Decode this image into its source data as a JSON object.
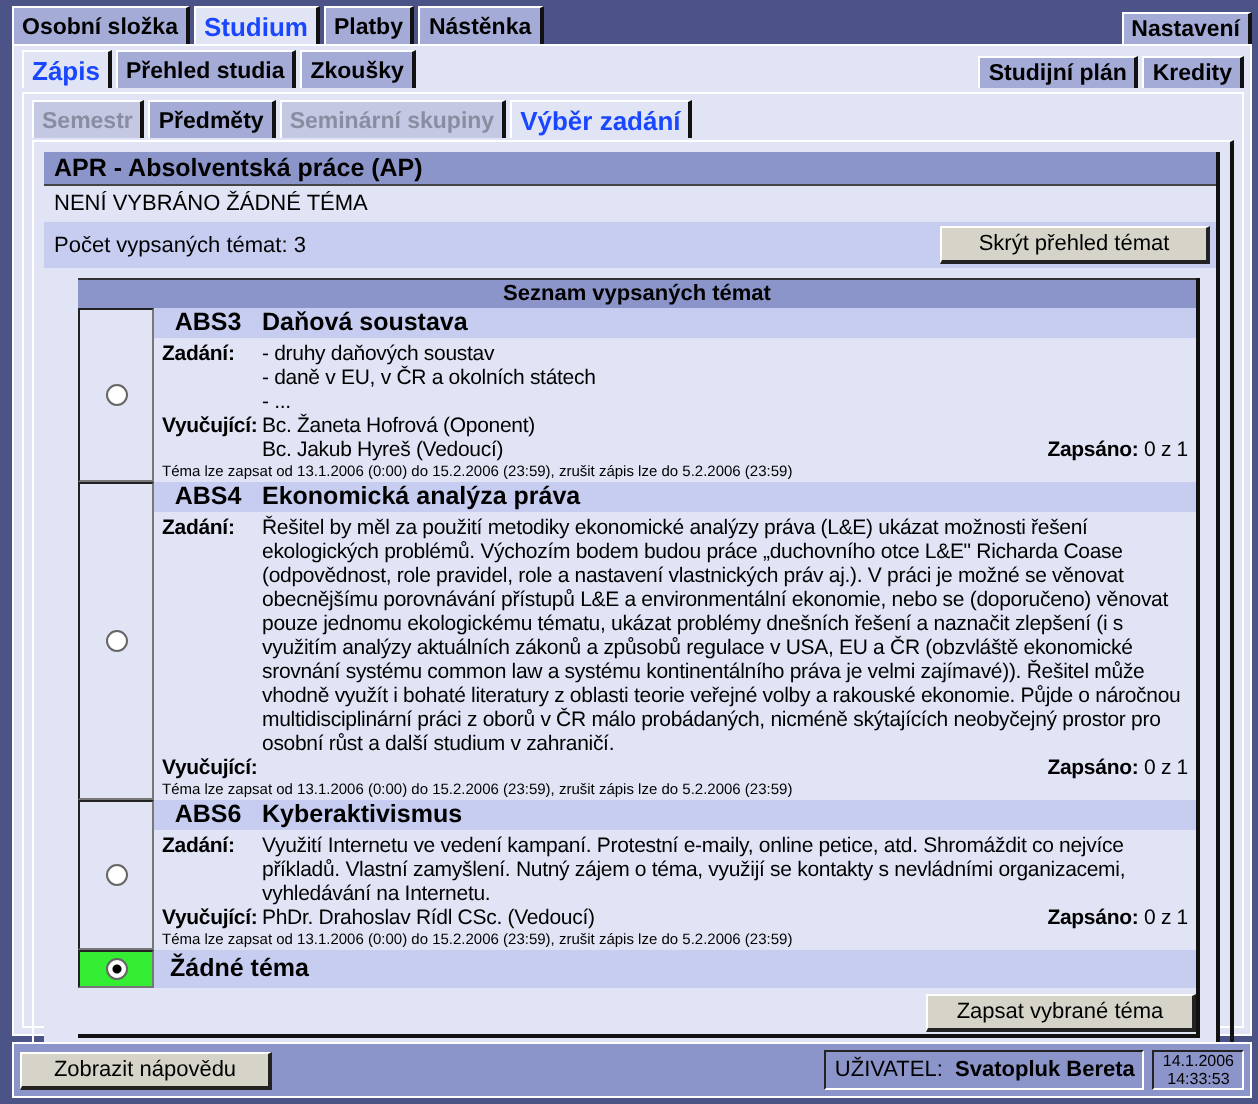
{
  "top_tabs": [
    {
      "label": "Osobní složka",
      "selected": false
    },
    {
      "label": "Studium",
      "selected": true
    },
    {
      "label": "Platby",
      "selected": false
    },
    {
      "label": "Nástěnka",
      "selected": false
    }
  ],
  "top_right_tabs": [
    {
      "label": "Nastavení",
      "selected": false
    }
  ],
  "sub_tabs": [
    {
      "label": "Zápis",
      "selected": true
    },
    {
      "label": "Přehled studia",
      "selected": false
    },
    {
      "label": "Zkoušky",
      "selected": false
    }
  ],
  "sub_right_tabs": [
    {
      "label": "Studijní plán",
      "selected": false
    },
    {
      "label": "Kredity",
      "selected": false
    }
  ],
  "section_tabs": [
    {
      "label": "Semestr",
      "selected": false,
      "disabled": true
    },
    {
      "label": "Předměty",
      "selected": false,
      "disabled": false
    },
    {
      "label": "Seminární skupiny",
      "selected": false,
      "disabled": true
    },
    {
      "label": "Výběr zadání",
      "selected": true,
      "disabled": false
    }
  ],
  "course": {
    "title": "APR - Absolventská práce (AP)",
    "status": "NENÍ VYBRÁNO ŽÁDNÉ TÉMA",
    "count": "Počet vypsaných témat: 3",
    "toggle_button": "Skrýt přehled témat"
  },
  "topics": {
    "heading": "Seznam vypsaných témat",
    "items": [
      {
        "kind": "topic",
        "selected": false,
        "code": "ABS3",
        "title": "Daňová soustava",
        "assignment_label": "Zadání:",
        "assignment": [
          "- druhy daňových soustav",
          "- daně v EU, v ČR a okolních státech",
          "- ..."
        ],
        "teachers_label": "Vyučující:",
        "teachers": [
          "Bc. Žaneta Hofrová (Oponent)",
          "Bc. Jakub Hyreš (Vedoucí)"
        ],
        "enrolled_label": "Zapsáno:",
        "enrolled": "0 z 1",
        "dates": "Téma lze zapsat od 13.1.2006 (0:00) do 15.2.2006 (23:59), zrušit zápis lze do 5.2.2006 (23:59)"
      },
      {
        "kind": "topic",
        "selected": false,
        "code": "ABS4",
        "title": "Ekonomická analýza práva",
        "assignment_label": "Zadání:",
        "assignment": [
          "Řešitel by měl za použití metodiky ekonomické analýzy práva (L&E) ukázat možnosti řešení ekologických problémů. Výchozím bodem budou práce „duchovního otce L&E\" Richarda Coase (odpovědnost, role pravidel, role a nastavení vlastnických práv aj.). V práci je možné se věnovat obecnějšímu porovnávání přístupů L&E a environmentální ekonomie, nebo se (doporučeno) věnovat pouze jednomu ekologickému tématu, ukázat problémy dnešních řešení a naznačit zlepšení (i s využitím analýzy aktuálních zákonů a způsobů regulace v USA, EU a ČR (obzvláště ekonomické srovnání systému common law a systému kontinentálního práva je velmi zajímavé)). Řešitel může vhodně využít i bohaté literatury z oblasti teorie veřejné volby a rakouské ekonomie. Půjde o náročnou multidisciplinární práci z oborů v ČR málo probádaných, nicméně skýtajících neobyčejný prostor pro osobní růst a další studium v zahraničí."
        ],
        "teachers_label": "Vyučující:",
        "enrolled_label": "Zapsáno:",
        "enrolled": "0 z 1",
        "dates": "Téma lze zapsat od 13.1.2006 (0:00) do 15.2.2006 (23:59), zrušit zápis lze do 5.2.2006 (23:59)"
      },
      {
        "kind": "topic",
        "selected": false,
        "code": "ABS6",
        "title": "Kyberaktivismus",
        "assignment_label": "Zadání:",
        "assignment": [
          "Využití Internetu ve vedení kampaní. Protestní e-maily, online petice, atd. Shromáždit co nejvíce příkladů. Vlastní zamyšlení. Nutný zájem o téma, využijí se kontakty s nevládními organizacemi, vyhledávání na Internetu."
        ],
        "teachers_label": "Vyučující:",
        "teachers": [
          "PhDr. Drahoslav Rídl CSc. (Vedoucí)"
        ],
        "enrolled_label": "Zapsáno:",
        "enrolled": "0 z 1",
        "dates": "Téma lze zapsat od 13.1.2006 (0:00) do 15.2.2006 (23:59), zrušit zápis lze do 5.2.2006 (23:59)"
      },
      {
        "kind": "none",
        "selected": true,
        "title": "Žádné téma"
      }
    ],
    "submit_button": "Zapsat vybrané téma"
  },
  "status_bar": {
    "help_button": "Zobrazit nápovědu",
    "user_label": "UŽIVATEL:",
    "user_name": "Svatopluk Bereta",
    "date": "14.1.2006",
    "time": "14:33:53"
  }
}
